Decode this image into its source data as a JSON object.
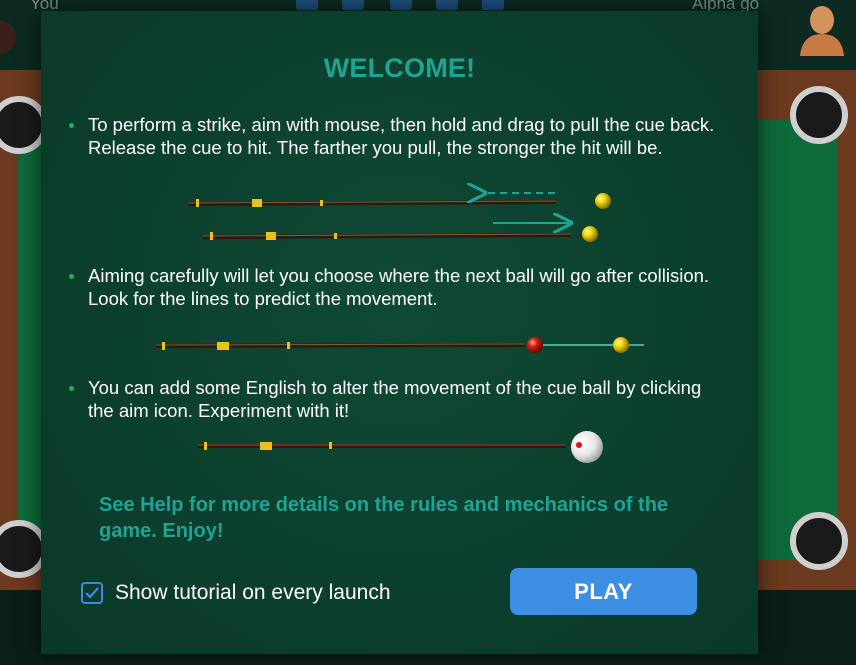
{
  "background": {
    "player_left": "You",
    "player_right": "Alpha go"
  },
  "modal": {
    "title": "WELCOME!",
    "bullets": [
      "To perform a strike, aim with mouse, then hold and drag to pull the cue back. Release the cue to hit. The farther you pull, the stronger the hit will be.",
      "Aiming carefully will let you choose where the next ball will go after collision. Look for the lines to predict the movement.",
      "You can add some English to alter the movement of the cue ball by clicking the aim icon. Experiment with it!"
    ],
    "help_text": "See Help for more details on the rules and mechanics of the game. Enjoy!",
    "checkbox": {
      "label": "Show tutorial on every launch",
      "checked": true
    },
    "play_label": "PLAY"
  },
  "colors": {
    "accent": "#1fa394",
    "button": "#3d8fe4",
    "modal_bg": "#0c3f2d",
    "bullet_dot": "#22b14c"
  }
}
